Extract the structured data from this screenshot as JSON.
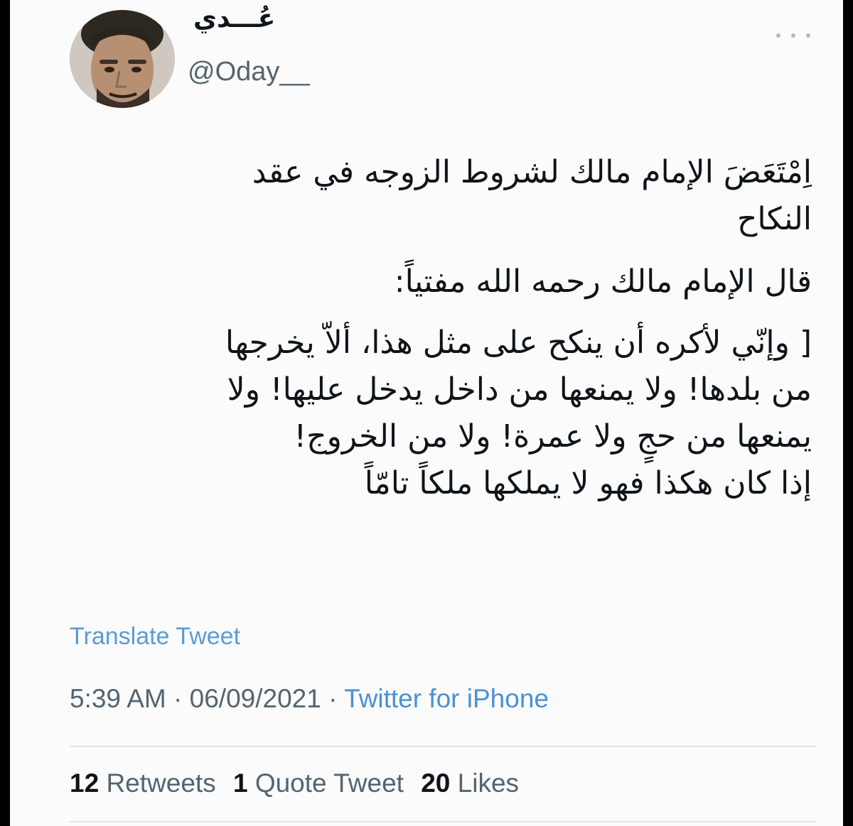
{
  "author": {
    "display_name": "عُـــدي",
    "handle": "@Oday__"
  },
  "icons": {
    "more": "more-horizontal-icon",
    "avatar": "profile-photo"
  },
  "tweet": {
    "lines": [
      "اِمْتَعَضَ الإمام مالك لشروط الزوجه في عقد",
      "النكاح",
      "قال الإمام مالك رحمه الله مفتياً:",
      "[ وإنّي لأكره أن ينكح على مثل هذا، ألاّ يخرجها",
      "من بلدها! ولا يمنعها من داخل يدخل عليها! ولا",
      "يمنعها من حجٍ ولا عمرة! ولا من الخروج!",
      "إذا كان هكذا فهو لا يملكها ملكاً تامّاً"
    ]
  },
  "translate_label": "Translate Tweet",
  "meta": {
    "time": "5:39 AM",
    "separator": " · ",
    "date": "06/09/2021",
    "source": "Twitter for iPhone"
  },
  "stats": {
    "retweets_count": "12",
    "retweets_label": "Retweets",
    "quotes_count": "1",
    "quotes_label": "Quote Tweet",
    "likes_count": "20",
    "likes_label": "Likes"
  },
  "colors": {
    "link": "#5b9bd5",
    "secondary_text": "#536471",
    "primary_text": "#0f1419",
    "background": "#fbfbfb"
  }
}
